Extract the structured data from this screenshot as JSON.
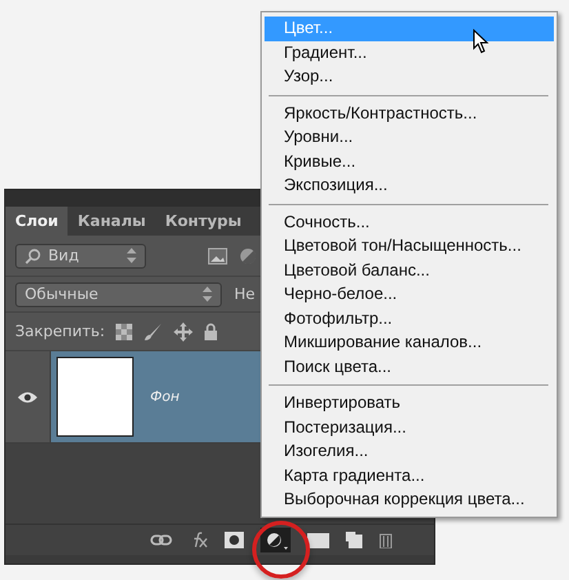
{
  "panel": {
    "tabs": [
      {
        "label": "Слои",
        "selected": true
      },
      {
        "label": "Каналы",
        "selected": false
      },
      {
        "label": "Контуры",
        "selected": false
      }
    ],
    "filter": {
      "value": "Вид"
    },
    "blend_mode": {
      "value": "Обычные"
    },
    "opacity_label": "Не",
    "lock_label": "Закрепить:",
    "layers": [
      {
        "name": "Фон",
        "selected": true,
        "visible": true
      }
    ]
  },
  "menu": {
    "groups": [
      [
        {
          "label": "Цвет...",
          "selected": true
        },
        {
          "label": "Градиент...",
          "selected": false
        },
        {
          "label": "Узор...",
          "selected": false
        }
      ],
      [
        {
          "label": "Яркость/Контрастность...",
          "selected": false
        },
        {
          "label": "Уровни...",
          "selected": false
        },
        {
          "label": "Кривые...",
          "selected": false
        },
        {
          "label": "Экспозиция...",
          "selected": false
        }
      ],
      [
        {
          "label": "Сочность...",
          "selected": false
        },
        {
          "label": "Цветовой тон/Насыщенность...",
          "selected": false
        },
        {
          "label": "Цветовой баланс...",
          "selected": false
        },
        {
          "label": "Черно-белое...",
          "selected": false
        },
        {
          "label": "Фотофильтр...",
          "selected": false
        },
        {
          "label": "Микширование каналов...",
          "selected": false
        },
        {
          "label": "Поиск цвета...",
          "selected": false
        }
      ],
      [
        {
          "label": "Инвертировать",
          "selected": false
        },
        {
          "label": "Постеризация...",
          "selected": false
        },
        {
          "label": "Изогелия...",
          "selected": false
        },
        {
          "label": "Карта градиента...",
          "selected": false
        },
        {
          "label": "Выборочная коррекция цвета...",
          "selected": false
        }
      ]
    ]
  }
}
